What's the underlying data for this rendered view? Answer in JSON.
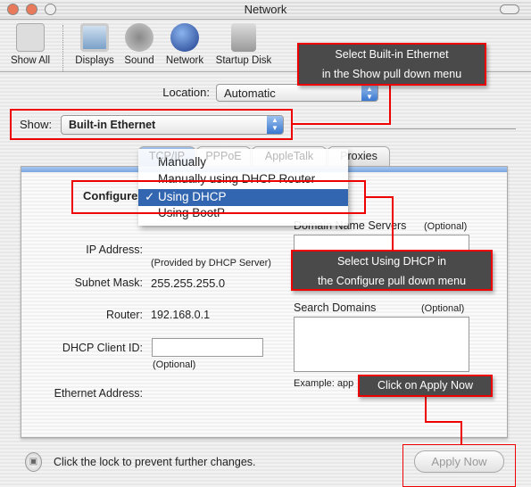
{
  "window": {
    "title": "Network"
  },
  "toolbar": {
    "items": [
      {
        "label": "Show All",
        "icon": "apple-prefs-icon"
      },
      {
        "label": "Displays",
        "icon": "display-icon"
      },
      {
        "label": "Sound",
        "icon": "speaker-icon"
      },
      {
        "label": "Network",
        "icon": "globe-icon"
      },
      {
        "label": "Startup Disk",
        "icon": "disk-icon"
      }
    ]
  },
  "location": {
    "label": "Location:",
    "value": "Automatic"
  },
  "show": {
    "label": "Show:",
    "value": "Built-in Ethernet"
  },
  "tabs": [
    "TCP/IP",
    "PPPoE",
    "AppleTalk",
    "Proxies"
  ],
  "configure": {
    "label": "Configure",
    "options": [
      "Manually",
      "Manually using DHCP Router",
      "Using DHCP",
      "Using BootP"
    ],
    "selected": "Using DHCP",
    "check": "✓"
  },
  "fields": {
    "ip_label": "IP Address:",
    "ip_note": "(Provided by DHCP Server)",
    "subnet_label": "Subnet Mask:",
    "subnet_value": "255.255.255.0",
    "router_label": "Router:",
    "router_value": "192.168.0.1",
    "client_id_label": "DHCP Client ID:",
    "client_id_value": "",
    "client_id_note": "(Optional)",
    "ethernet_label": "Ethernet Address:"
  },
  "dns": {
    "label": "Domain Name Servers",
    "optional": "(Optional)"
  },
  "search": {
    "label": "Search Domains",
    "optional": "(Optional)",
    "example": "Example: app"
  },
  "lock_text": "Click the lock to prevent further changes.",
  "apply_label": "Apply Now",
  "callouts": {
    "show": [
      "Select Built-in Ethernet",
      "in the Show pull down menu"
    ],
    "configure": [
      "Select Using DHCP in",
      "the Configure pull down menu"
    ],
    "apply": "Click on Apply Now"
  },
  "colors": {
    "highlight": "#3366b0",
    "callout_border": "#e00000",
    "callout_bg": "#4a4a4a"
  }
}
